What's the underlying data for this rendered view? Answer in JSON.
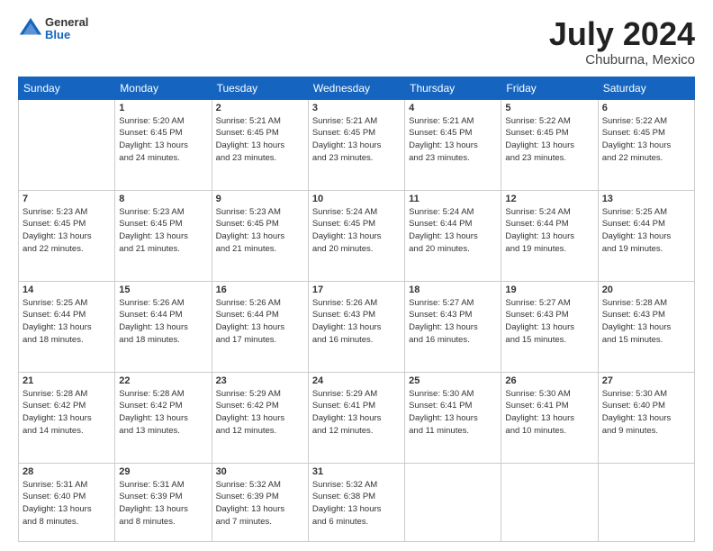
{
  "header": {
    "logo": {
      "general": "General",
      "blue": "Blue"
    },
    "title": "July 2024",
    "location": "Chuburna, Mexico"
  },
  "calendar": {
    "days_of_week": [
      "Sunday",
      "Monday",
      "Tuesday",
      "Wednesday",
      "Thursday",
      "Friday",
      "Saturday"
    ],
    "weeks": [
      [
        {
          "day": "",
          "info": ""
        },
        {
          "day": "1",
          "info": "Sunrise: 5:20 AM\nSunset: 6:45 PM\nDaylight: 13 hours\nand 24 minutes."
        },
        {
          "day": "2",
          "info": "Sunrise: 5:21 AM\nSunset: 6:45 PM\nDaylight: 13 hours\nand 23 minutes."
        },
        {
          "day": "3",
          "info": "Sunrise: 5:21 AM\nSunset: 6:45 PM\nDaylight: 13 hours\nand 23 minutes."
        },
        {
          "day": "4",
          "info": "Sunrise: 5:21 AM\nSunset: 6:45 PM\nDaylight: 13 hours\nand 23 minutes."
        },
        {
          "day": "5",
          "info": "Sunrise: 5:22 AM\nSunset: 6:45 PM\nDaylight: 13 hours\nand 23 minutes."
        },
        {
          "day": "6",
          "info": "Sunrise: 5:22 AM\nSunset: 6:45 PM\nDaylight: 13 hours\nand 22 minutes."
        }
      ],
      [
        {
          "day": "7",
          "info": "Sunrise: 5:23 AM\nSunset: 6:45 PM\nDaylight: 13 hours\nand 22 minutes."
        },
        {
          "day": "8",
          "info": "Sunrise: 5:23 AM\nSunset: 6:45 PM\nDaylight: 13 hours\nand 21 minutes."
        },
        {
          "day": "9",
          "info": "Sunrise: 5:23 AM\nSunset: 6:45 PM\nDaylight: 13 hours\nand 21 minutes."
        },
        {
          "day": "10",
          "info": "Sunrise: 5:24 AM\nSunset: 6:45 PM\nDaylight: 13 hours\nand 20 minutes."
        },
        {
          "day": "11",
          "info": "Sunrise: 5:24 AM\nSunset: 6:44 PM\nDaylight: 13 hours\nand 20 minutes."
        },
        {
          "day": "12",
          "info": "Sunrise: 5:24 AM\nSunset: 6:44 PM\nDaylight: 13 hours\nand 19 minutes."
        },
        {
          "day": "13",
          "info": "Sunrise: 5:25 AM\nSunset: 6:44 PM\nDaylight: 13 hours\nand 19 minutes."
        }
      ],
      [
        {
          "day": "14",
          "info": "Sunrise: 5:25 AM\nSunset: 6:44 PM\nDaylight: 13 hours\nand 18 minutes."
        },
        {
          "day": "15",
          "info": "Sunrise: 5:26 AM\nSunset: 6:44 PM\nDaylight: 13 hours\nand 18 minutes."
        },
        {
          "day": "16",
          "info": "Sunrise: 5:26 AM\nSunset: 6:44 PM\nDaylight: 13 hours\nand 17 minutes."
        },
        {
          "day": "17",
          "info": "Sunrise: 5:26 AM\nSunset: 6:43 PM\nDaylight: 13 hours\nand 16 minutes."
        },
        {
          "day": "18",
          "info": "Sunrise: 5:27 AM\nSunset: 6:43 PM\nDaylight: 13 hours\nand 16 minutes."
        },
        {
          "day": "19",
          "info": "Sunrise: 5:27 AM\nSunset: 6:43 PM\nDaylight: 13 hours\nand 15 minutes."
        },
        {
          "day": "20",
          "info": "Sunrise: 5:28 AM\nSunset: 6:43 PM\nDaylight: 13 hours\nand 15 minutes."
        }
      ],
      [
        {
          "day": "21",
          "info": "Sunrise: 5:28 AM\nSunset: 6:42 PM\nDaylight: 13 hours\nand 14 minutes."
        },
        {
          "day": "22",
          "info": "Sunrise: 5:28 AM\nSunset: 6:42 PM\nDaylight: 13 hours\nand 13 minutes."
        },
        {
          "day": "23",
          "info": "Sunrise: 5:29 AM\nSunset: 6:42 PM\nDaylight: 13 hours\nand 12 minutes."
        },
        {
          "day": "24",
          "info": "Sunrise: 5:29 AM\nSunset: 6:41 PM\nDaylight: 13 hours\nand 12 minutes."
        },
        {
          "day": "25",
          "info": "Sunrise: 5:30 AM\nSunset: 6:41 PM\nDaylight: 13 hours\nand 11 minutes."
        },
        {
          "day": "26",
          "info": "Sunrise: 5:30 AM\nSunset: 6:41 PM\nDaylight: 13 hours\nand 10 minutes."
        },
        {
          "day": "27",
          "info": "Sunrise: 5:30 AM\nSunset: 6:40 PM\nDaylight: 13 hours\nand 9 minutes."
        }
      ],
      [
        {
          "day": "28",
          "info": "Sunrise: 5:31 AM\nSunset: 6:40 PM\nDaylight: 13 hours\nand 8 minutes."
        },
        {
          "day": "29",
          "info": "Sunrise: 5:31 AM\nSunset: 6:39 PM\nDaylight: 13 hours\nand 8 minutes."
        },
        {
          "day": "30",
          "info": "Sunrise: 5:32 AM\nSunset: 6:39 PM\nDaylight: 13 hours\nand 7 minutes."
        },
        {
          "day": "31",
          "info": "Sunrise: 5:32 AM\nSunset: 6:38 PM\nDaylight: 13 hours\nand 6 minutes."
        },
        {
          "day": "",
          "info": ""
        },
        {
          "day": "",
          "info": ""
        },
        {
          "day": "",
          "info": ""
        }
      ]
    ]
  }
}
